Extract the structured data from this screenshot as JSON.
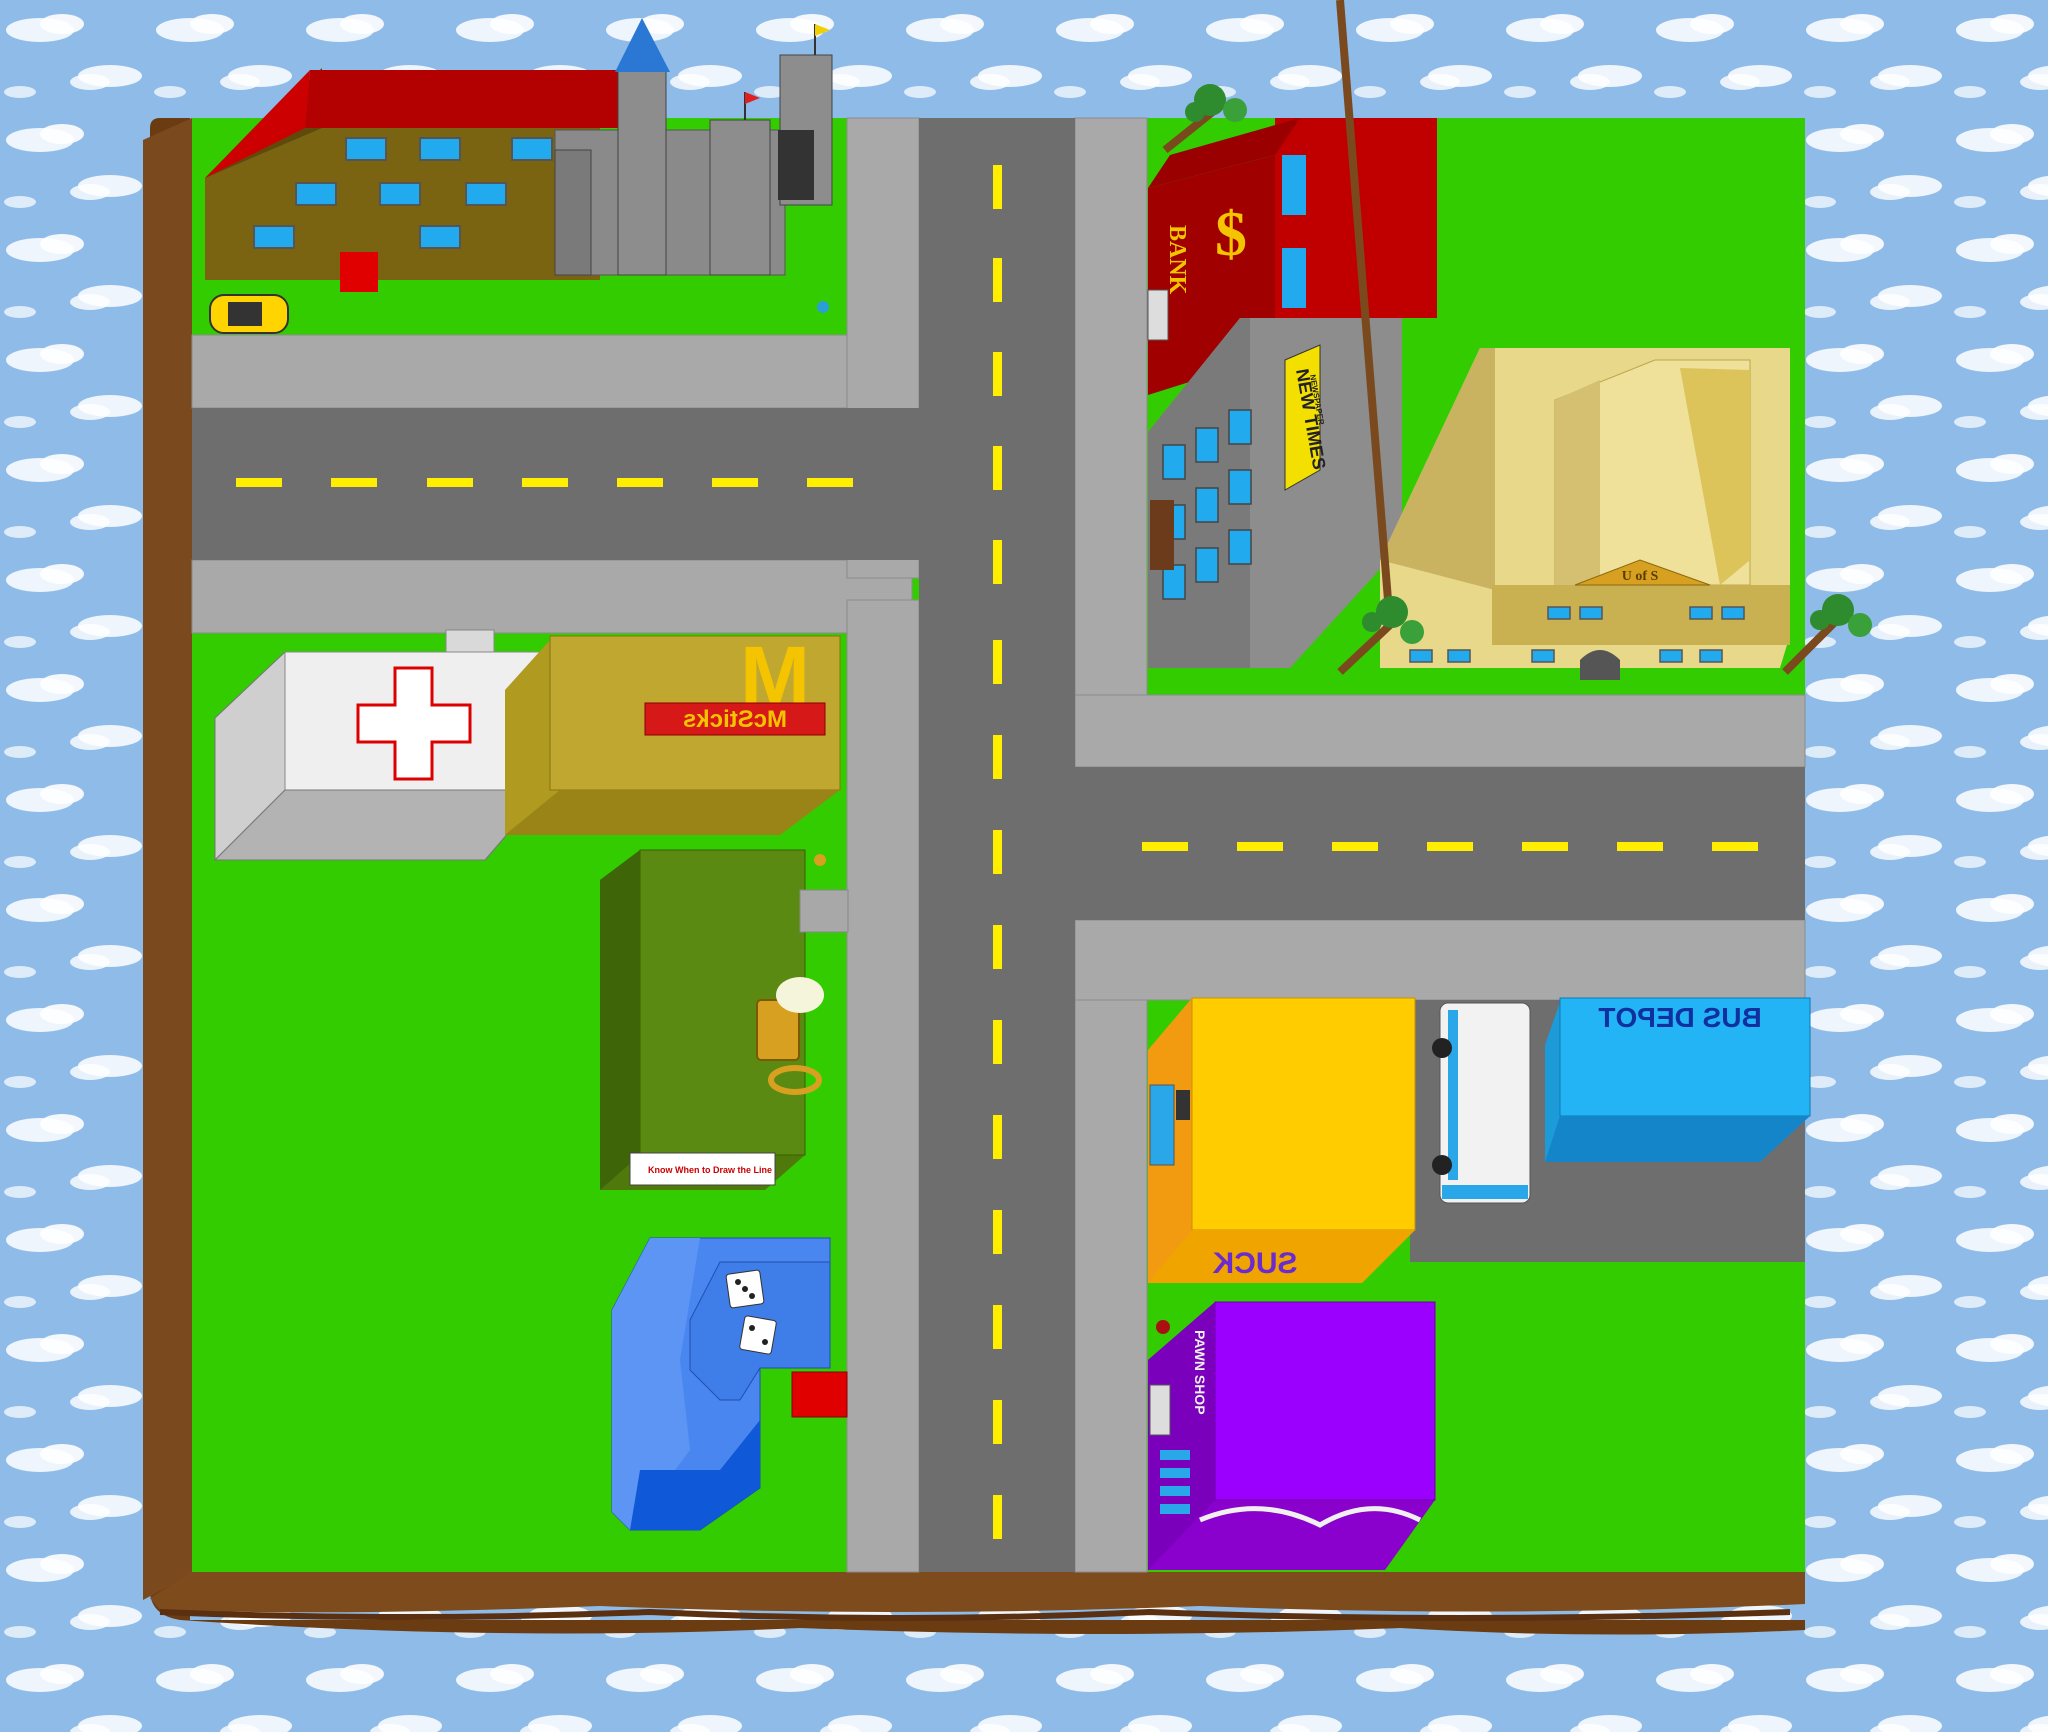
{
  "scene": {
    "title": "",
    "colors": {
      "sky": "#8fbbe8",
      "cloud": "#ffffff",
      "grass": "#33cc00",
      "road": "#6e6e6e",
      "sidewalk": "#a7a7a7",
      "lane_mark": "#ffee00",
      "dirt": "#7a4a1e"
    }
  },
  "buildings": {
    "school": {
      "icon": "school-building"
    },
    "castle": {
      "icon": "castle"
    },
    "bank": {
      "sign": "BANK",
      "symbol": "$"
    },
    "news": {
      "sign_line1": "NEW TIMES",
      "sign_line2": "NEWSPAPER"
    },
    "university": {
      "sign": "U of S"
    },
    "hospital": {
      "icon": "red-cross"
    },
    "restaurant": {
      "sign": "McSticks",
      "logo": "M"
    },
    "bar": {
      "banner": "Know When to Draw the Line"
    },
    "casino": {
      "icon": "dice"
    },
    "shop": {
      "graffiti": "SUCK"
    },
    "bus_depot": {
      "sign": "BUS DEPOT"
    },
    "pawn_shop": {
      "sign": "PAWN SHOP"
    }
  },
  "vehicles": {
    "taxi": {
      "color": "#ffd400"
    },
    "bus": {
      "color": "#f2f2f2"
    }
  }
}
